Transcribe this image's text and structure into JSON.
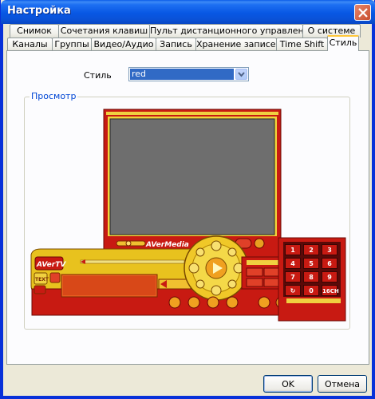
{
  "window": {
    "title": "Настройка"
  },
  "tabs_row1": [
    "Снимок",
    "Сочетания клавиш",
    "Пульт дистанционного управления",
    "О системе"
  ],
  "tabs_row2": [
    "Каналы",
    "Группы",
    "Видео/Аудио",
    "Запись",
    "Хранение записей",
    "Time Shift",
    "Стиль"
  ],
  "active_tab": "Стиль",
  "style": {
    "label": "Стиль",
    "value": "red"
  },
  "preview": {
    "legend": "Просмотр",
    "brand_label": "AVerMedia",
    "control_brand": "AVerTV",
    "text_button": "TEXT",
    "keypad": [
      "1",
      "2",
      "3",
      "4",
      "5",
      "6",
      "7",
      "8",
      "9",
      "0",
      "16CH"
    ],
    "colors": {
      "accent": "#cc1a10",
      "panel": "#e8c21e",
      "screen": "#6e6e6e"
    }
  },
  "buttons": {
    "ok": "OK",
    "cancel": "Отмена"
  }
}
